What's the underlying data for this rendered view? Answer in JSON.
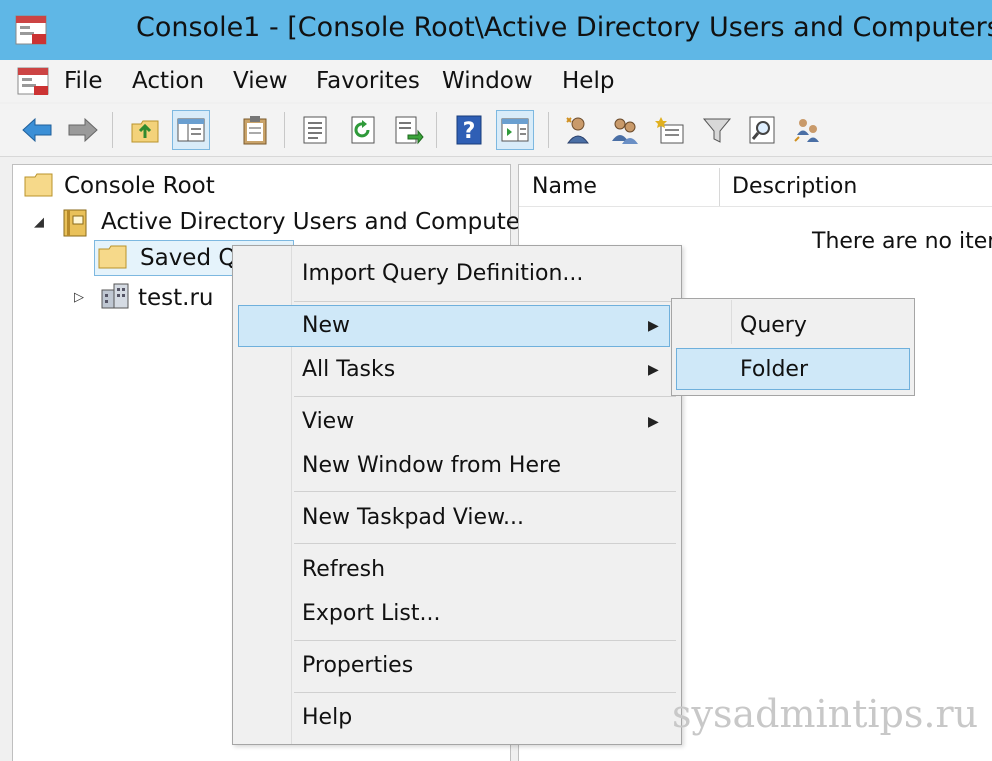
{
  "window": {
    "title": "Console1 - [Console Root\\Active Directory Users and Computers"
  },
  "menubar": {
    "items": [
      "File",
      "Action",
      "View",
      "Favorites",
      "Window",
      "Help"
    ]
  },
  "toolbar": {
    "icons": [
      "back-arrow-icon",
      "forward-arrow-icon",
      "up-folder-icon",
      "show-hide-tree-icon",
      "clipboard-icon",
      "properties-icon",
      "refresh-icon",
      "export-list-icon",
      "help-icon",
      "show-action-pane-icon",
      "find-user-icon",
      "users-icon",
      "new-object-icon",
      "filter-icon",
      "find-icon",
      "group-users-icon"
    ]
  },
  "tree": {
    "root": "Console Root",
    "aduc": "Active Directory Users and Computers",
    "saved_queries": "Saved Qu",
    "domain": "test.ru"
  },
  "list": {
    "columns": [
      "Name",
      "Description"
    ],
    "empty_message": "There are no item"
  },
  "context_menu": {
    "import": "Import Query Definition...",
    "new": "New",
    "all_tasks": "All Tasks",
    "view": "View",
    "new_window": "New Window from Here",
    "new_taskpad": "New Taskpad View...",
    "refresh": "Refresh",
    "export": "Export List...",
    "properties": "Properties",
    "help": "Help"
  },
  "submenu": {
    "query": "Query",
    "folder": "Folder"
  },
  "watermark": "sysadmintips.ru",
  "colors": {
    "titlebar": "#5fb7e6",
    "highlight": "#cfe8f8",
    "highlight_border": "#6fb0dc"
  }
}
